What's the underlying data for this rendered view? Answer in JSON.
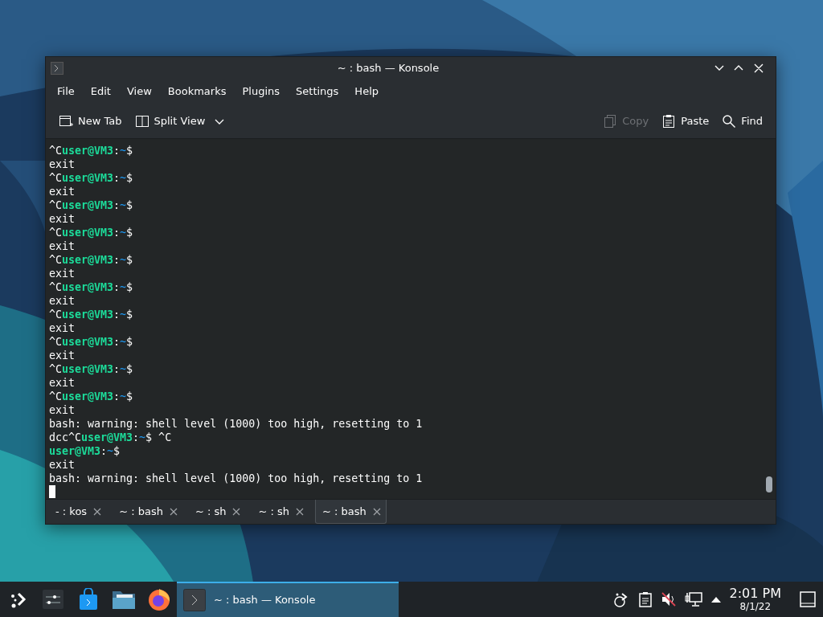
{
  "window": {
    "title": "~ : bash — Konsole"
  },
  "menu": [
    "File",
    "Edit",
    "View",
    "Bookmarks",
    "Plugins",
    "Settings",
    "Help"
  ],
  "toolbar": {
    "left": [
      {
        "label": "New Tab",
        "kind": "new-tab",
        "disabled": false
      },
      {
        "label": "Split View",
        "kind": "split-view",
        "disabled": false
      }
    ],
    "right": [
      {
        "label": "Copy",
        "kind": "copy",
        "disabled": true
      },
      {
        "label": "Paste",
        "kind": "paste",
        "disabled": false
      },
      {
        "label": "Find",
        "kind": "find",
        "disabled": false
      }
    ]
  },
  "terminal": {
    "cursor": true,
    "lines": [
      {
        "segments": [
          {
            "text": "^C",
            "kind": "plain"
          },
          {
            "text": "user@VM3",
            "kind": "user"
          },
          {
            "text": ":",
            "kind": "plain"
          },
          {
            "text": "~",
            "kind": "path"
          },
          {
            "text": "$",
            "kind": "plain"
          }
        ]
      },
      {
        "segments": [
          {
            "text": "exit",
            "kind": "plain"
          }
        ]
      },
      {
        "segments": [
          {
            "text": "^C",
            "kind": "plain"
          },
          {
            "text": "user@VM3",
            "kind": "user"
          },
          {
            "text": ":",
            "kind": "plain"
          },
          {
            "text": "~",
            "kind": "path"
          },
          {
            "text": "$",
            "kind": "plain"
          }
        ]
      },
      {
        "segments": [
          {
            "text": "exit",
            "kind": "plain"
          }
        ]
      },
      {
        "segments": [
          {
            "text": "^C",
            "kind": "plain"
          },
          {
            "text": "user@VM3",
            "kind": "user"
          },
          {
            "text": ":",
            "kind": "plain"
          },
          {
            "text": "~",
            "kind": "path"
          },
          {
            "text": "$",
            "kind": "plain"
          }
        ]
      },
      {
        "segments": [
          {
            "text": "exit",
            "kind": "plain"
          }
        ]
      },
      {
        "segments": [
          {
            "text": "^C",
            "kind": "plain"
          },
          {
            "text": "user@VM3",
            "kind": "user"
          },
          {
            "text": ":",
            "kind": "plain"
          },
          {
            "text": "~",
            "kind": "path"
          },
          {
            "text": "$",
            "kind": "plain"
          }
        ]
      },
      {
        "segments": [
          {
            "text": "exit",
            "kind": "plain"
          }
        ]
      },
      {
        "segments": [
          {
            "text": "^C",
            "kind": "plain"
          },
          {
            "text": "user@VM3",
            "kind": "user"
          },
          {
            "text": ":",
            "kind": "plain"
          },
          {
            "text": "~",
            "kind": "path"
          },
          {
            "text": "$",
            "kind": "plain"
          }
        ]
      },
      {
        "segments": [
          {
            "text": "exit",
            "kind": "plain"
          }
        ]
      },
      {
        "segments": [
          {
            "text": "^C",
            "kind": "plain"
          },
          {
            "text": "user@VM3",
            "kind": "user"
          },
          {
            "text": ":",
            "kind": "plain"
          },
          {
            "text": "~",
            "kind": "path"
          },
          {
            "text": "$",
            "kind": "plain"
          }
        ]
      },
      {
        "segments": [
          {
            "text": "exit",
            "kind": "plain"
          }
        ]
      },
      {
        "segments": [
          {
            "text": "^C",
            "kind": "plain"
          },
          {
            "text": "user@VM3",
            "kind": "user"
          },
          {
            "text": ":",
            "kind": "plain"
          },
          {
            "text": "~",
            "kind": "path"
          },
          {
            "text": "$",
            "kind": "plain"
          }
        ]
      },
      {
        "segments": [
          {
            "text": "exit",
            "kind": "plain"
          }
        ]
      },
      {
        "segments": [
          {
            "text": "^C",
            "kind": "plain"
          },
          {
            "text": "user@VM3",
            "kind": "user"
          },
          {
            "text": ":",
            "kind": "plain"
          },
          {
            "text": "~",
            "kind": "path"
          },
          {
            "text": "$",
            "kind": "plain"
          }
        ]
      },
      {
        "segments": [
          {
            "text": "exit",
            "kind": "plain"
          }
        ]
      },
      {
        "segments": [
          {
            "text": "^C",
            "kind": "plain"
          },
          {
            "text": "user@VM3",
            "kind": "user"
          },
          {
            "text": ":",
            "kind": "plain"
          },
          {
            "text": "~",
            "kind": "path"
          },
          {
            "text": "$",
            "kind": "plain"
          }
        ]
      },
      {
        "segments": [
          {
            "text": "exit",
            "kind": "plain"
          }
        ]
      },
      {
        "segments": [
          {
            "text": "^C",
            "kind": "plain"
          },
          {
            "text": "user@VM3",
            "kind": "user"
          },
          {
            "text": ":",
            "kind": "plain"
          },
          {
            "text": "~",
            "kind": "path"
          },
          {
            "text": "$",
            "kind": "plain"
          }
        ]
      },
      {
        "segments": [
          {
            "text": "exit",
            "kind": "plain"
          }
        ]
      },
      {
        "segments": [
          {
            "text": "bash: warning: shell level (1000) too high, resetting to 1",
            "kind": "plain"
          }
        ]
      },
      {
        "segments": [
          {
            "text": "dcc^C",
            "kind": "plain"
          },
          {
            "text": "user@VM3",
            "kind": "user"
          },
          {
            "text": ":",
            "kind": "plain"
          },
          {
            "text": "~",
            "kind": "path"
          },
          {
            "text": "$ ^C",
            "kind": "plain"
          }
        ]
      },
      {
        "segments": [
          {
            "text": "user@VM3",
            "kind": "user"
          },
          {
            "text": ":",
            "kind": "plain"
          },
          {
            "text": "~",
            "kind": "path"
          },
          {
            "text": "$",
            "kind": "plain"
          }
        ]
      },
      {
        "segments": [
          {
            "text": "exit",
            "kind": "plain"
          }
        ]
      },
      {
        "segments": [
          {
            "text": "bash: warning: shell level (1000) too high, resetting to 1",
            "kind": "plain"
          }
        ]
      }
    ]
  },
  "tabs": [
    {
      "label": "- : kos",
      "selected": false
    },
    {
      "label": "~ : bash",
      "selected": false
    },
    {
      "label": "~ : sh",
      "selected": false
    },
    {
      "label": "~ : sh",
      "selected": false
    },
    {
      "label": "~ : bash",
      "selected": true
    }
  ],
  "taskbar": {
    "task": {
      "label": "~ : bash — Konsole",
      "selected": true
    },
    "volume": {
      "muted": true
    },
    "clock": {
      "time": "2:01 PM",
      "date": "8/1/22"
    }
  }
}
